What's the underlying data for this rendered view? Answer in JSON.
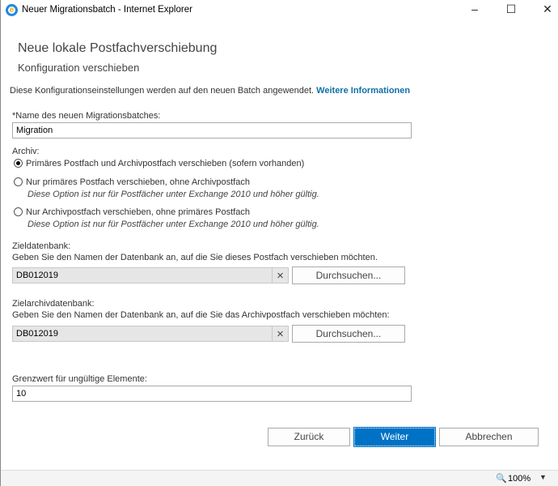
{
  "window": {
    "title": "Neuer Migrationsbatch - Internet Explorer",
    "minimize": "–",
    "maximize": "☐",
    "close": "✕"
  },
  "header": {
    "title": "Neue lokale Postfachverschiebung",
    "subtitle": "Konfiguration verschieben"
  },
  "intro": {
    "text": "Diese Konfigurationseinstellungen werden auf den neuen Batch angewendet.",
    "link": "Weitere Informationen"
  },
  "batch_name": {
    "label": "*Name des neuen Migrationsbatches:",
    "value": "Migration"
  },
  "archive": {
    "label": "Archiv:",
    "options": [
      {
        "label": "Primäres Postfach und Archivpostfach verschieben (sofern vorhanden)",
        "note": "",
        "selected": true
      },
      {
        "label": "Nur primäres Postfach verschieben, ohne Archivpostfach",
        "note": "Diese Option ist nur für Postfächer unter Exchange 2010 und höher gültig.",
        "selected": false
      },
      {
        "label": "Nur Archivpostfach verschieben, ohne primäres Postfach",
        "note": "Diese Option ist nur für Postfächer unter Exchange 2010 und höher gültig.",
        "selected": false
      }
    ]
  },
  "target_db": {
    "label": "Zieldatenbank:",
    "help": "Geben Sie den Namen der Datenbank an, auf die Sie dieses Postfach verschieben möchten.",
    "value": "DB012019",
    "browse": "Durchsuchen..."
  },
  "archive_db": {
    "label": "Zielarchivdatenbank:",
    "help": "Geben Sie den Namen der Datenbank an, auf die Sie das Archivpostfach verschieben möchten:",
    "value": "DB012019",
    "browse": "Durchsuchen..."
  },
  "bad_items": {
    "label": "Grenzwert für ungültige Elemente:",
    "value": "10"
  },
  "buttons": {
    "back": "Zurück",
    "next": "Weiter",
    "cancel": "Abbrechen"
  },
  "statusbar": {
    "zoom": "100%"
  },
  "colors": {
    "primary": "#0072c6",
    "link": "#1170a8"
  }
}
